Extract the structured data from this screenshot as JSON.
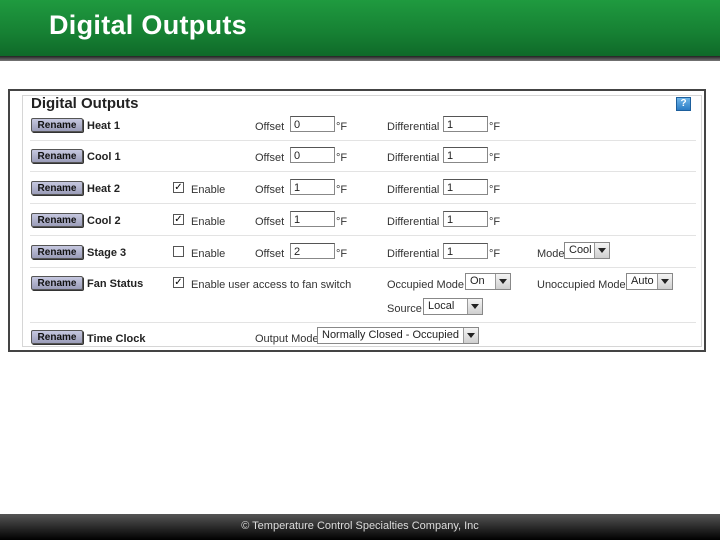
{
  "header": {
    "title": "Digital Outputs"
  },
  "footer": {
    "text": "© Temperature Control Specialties Company, Inc"
  },
  "panel": {
    "title": "Digital Outputs",
    "help_icon": "question-icon"
  },
  "labels": {
    "rename": "Rename",
    "offset": "Offset",
    "unit": "°F",
    "differential": "Differential",
    "enable": "Enable",
    "mode": "Mode",
    "enable_fan": "Enable user access to fan switch",
    "occupied_mode": "Occupied Mode",
    "unoccupied_mode": "Unoccupied Mode",
    "source": "Source",
    "output_mode": "Output Mode"
  },
  "rows": [
    {
      "name": "Heat 1",
      "offset": "0",
      "differential": "1"
    },
    {
      "name": "Cool 1",
      "offset": "0",
      "differential": "1"
    },
    {
      "name": "Heat 2",
      "offset": "1",
      "differential": "1",
      "enabled": true
    },
    {
      "name": "Cool 2",
      "offset": "1",
      "differential": "1",
      "enabled": true
    },
    {
      "name": "Stage 3",
      "offset": "2",
      "differential": "1",
      "enabled": false,
      "mode": "Cool"
    },
    {
      "name": "Fan Status",
      "enabled": true,
      "occupied_mode": "On",
      "unoccupied_mode": "Auto",
      "source": "Local"
    },
    {
      "name": "Time Clock",
      "output_mode": "Normally Closed - Occupied"
    }
  ]
}
